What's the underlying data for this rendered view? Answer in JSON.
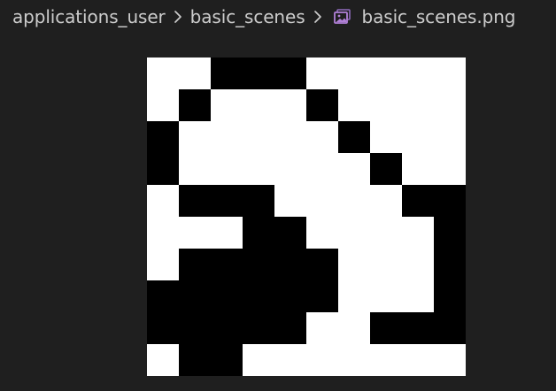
{
  "breadcrumb": {
    "items": [
      {
        "label": "applications_user",
        "icon": null
      },
      {
        "label": "basic_scenes",
        "icon": null
      },
      {
        "label": "basic_scenes.png",
        "icon": "image-file-icon"
      }
    ],
    "separator_icon": "chevron-right-icon"
  },
  "image": {
    "name": "basic_scenes.png",
    "grid_size": 10,
    "pixels": [
      "1100011111",
      "1011101111",
      "0111110111",
      "0111111011",
      "1000111100",
      "1110011110",
      "1000001110",
      "0000001110",
      "0000011000",
      "1001111111"
    ],
    "colors": {
      "on": "#ffffff",
      "off": "#000000"
    }
  },
  "theme": {
    "background": "#1f1f1f",
    "text": "#cccccc",
    "icon_accent": "#b180d7"
  }
}
